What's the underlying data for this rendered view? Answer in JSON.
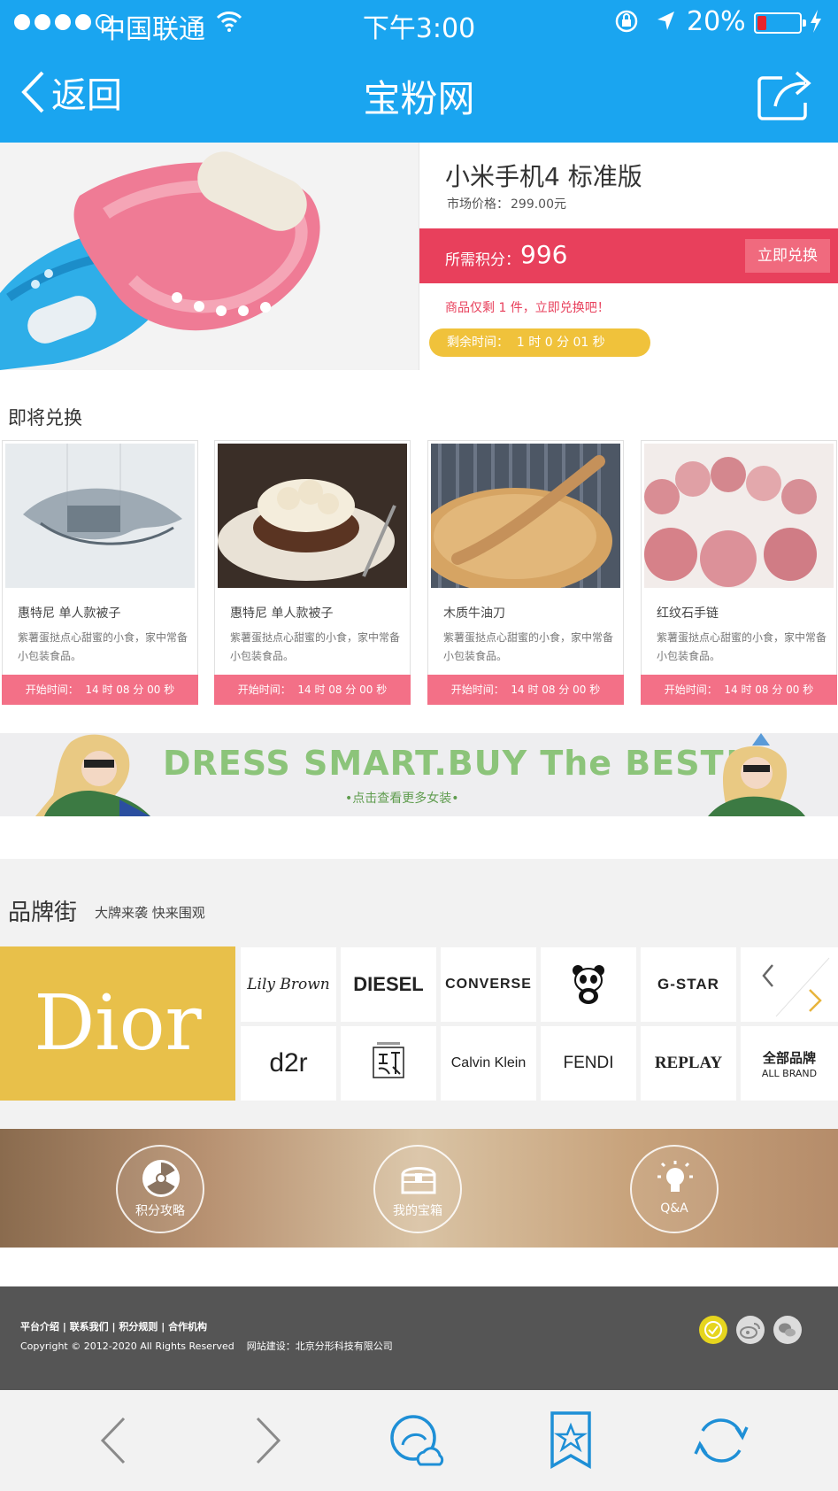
{
  "status_bar": {
    "carrier": "中国联通",
    "time": "下午3:00",
    "battery_percent": "20%",
    "battery_level": 0.2
  },
  "nav": {
    "back_label": "返回",
    "title": "宝粉网"
  },
  "product": {
    "name": "小米手机4 标准版",
    "market_price_label": "市场价格：",
    "market_price": "299.00元",
    "points_label": "所需积分：",
    "points_value": "996",
    "redeem_button": "立即兑换",
    "stock_note": "商品仅剩 1 件，立即兑换吧！",
    "timer": "剩余时间：  1 时 0 分 01 秒"
  },
  "upcoming": {
    "title": "即将兑换",
    "items": [
      {
        "name": "惠特尼 单人款被子",
        "desc": "紫薯蛋挞点心甜蜜的小食，家中常备小包装食品。",
        "start": "开始时间：  14 时 08 分 00 秒"
      },
      {
        "name": "惠特尼 单人款被子",
        "desc": "紫薯蛋挞点心甜蜜的小食，家中常备小包装食品。",
        "start": "开始时间：  14 时 08 分 00 秒"
      },
      {
        "name": "木质牛油刀",
        "desc": "紫薯蛋挞点心甜蜜的小食，家中常备小包装食品。",
        "start": "开始时间：  14 时 08 分 00 秒"
      },
      {
        "name": "红纹石手链",
        "desc": "紫薯蛋挞点心甜蜜的小食，家中常备小包装食品。",
        "start": "开始时间：  14 时 08 分 00 秒"
      }
    ]
  },
  "banner": {
    "slogan": "DRESS SMART.BUY The BEST!",
    "sub": "•点击查看更多女装•"
  },
  "brands": {
    "title": "品牌街",
    "subtitle": "大牌来袭 快来围观",
    "featured": "Dior",
    "row1": [
      "Lily Brown",
      "DIESEL",
      "CONVERSE",
      "",
      "G-STAR"
    ],
    "row2": [
      "d2r",
      "",
      "Calvin Klein",
      "FENDI",
      "REPLAY"
    ],
    "all_brand_cn": "全部品牌",
    "all_brand_en": "ALL BRAND"
  },
  "features": [
    {
      "label": "积分攻略",
      "icon": "radiation-icon"
    },
    {
      "label": "我的宝箱",
      "icon": "treasure-chest-icon"
    },
    {
      "label": "Q&A",
      "icon": "lightbulb-icon"
    }
  ],
  "footer": {
    "links": [
      "平台介绍",
      "联系我们",
      "积分规则",
      "合作机构"
    ],
    "copyright": "Copyright © 2012-2020  All Rights Reserved",
    "builder": "网站建设：北京分形科技有限公司"
  },
  "colors": {
    "nav_blue": "#1aa5f0",
    "accent_red": "#e8405c",
    "timer_yellow": "#f0c23b",
    "dior_gold": "#e8c04a"
  }
}
